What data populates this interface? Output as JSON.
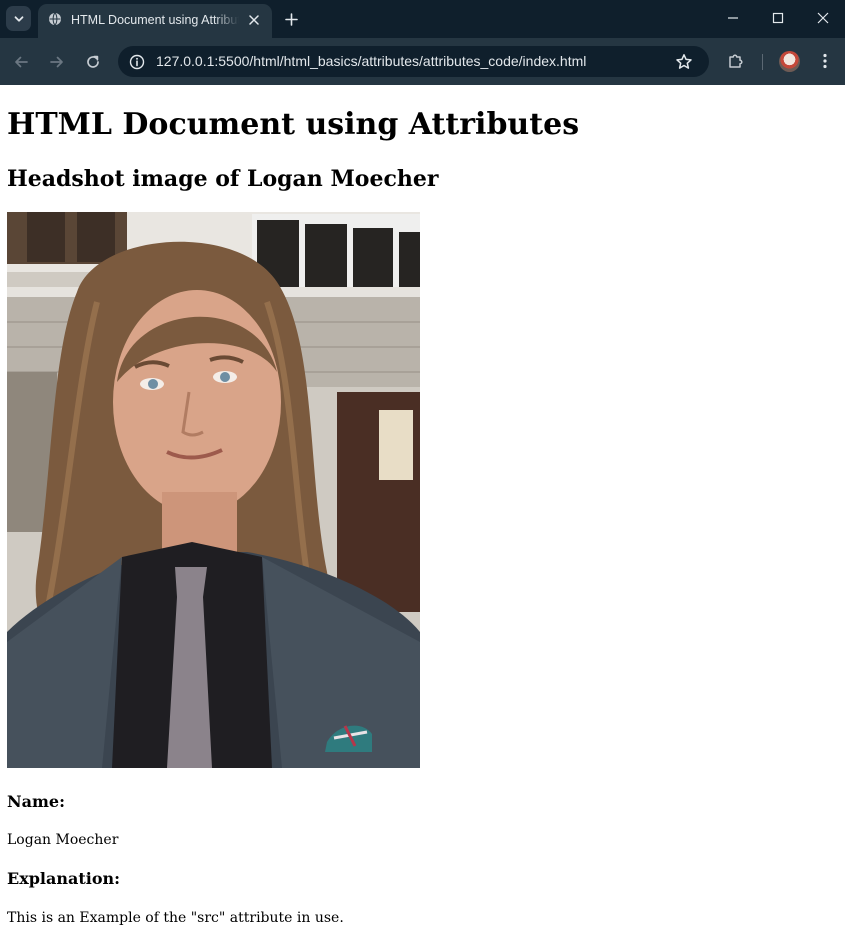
{
  "browser": {
    "tab": {
      "title": "HTML Document using Attributes"
    },
    "address_bar": {
      "url": "127.0.0.1:5500/html/html_basics/attributes/attributes_code/index.html"
    },
    "icons": {
      "tab_search": "chevron-down-icon",
      "favicon": "globe-icon",
      "tab_close": "close-icon",
      "new_tab": "plus-icon",
      "minimize": "minimize-icon",
      "maximize": "maximize-icon",
      "close_window": "close-icon",
      "back": "arrow-left-icon",
      "forward": "arrow-right-icon",
      "reload": "reload-icon",
      "site_info": "info-icon",
      "bookmark": "star-icon",
      "extensions": "puzzle-icon",
      "menu": "more-vertical-icon"
    },
    "colors": {
      "frame": "#0f1f2c",
      "toolbar": "#253642",
      "omnibox": "#0f1f2c",
      "text": "#e3e8ec",
      "icon": "#c6ccd2",
      "icon_disabled": "#6b7782"
    }
  },
  "page": {
    "heading": "HTML Document using Attributes",
    "subheading": "Headshot image of Logan Moecher",
    "name_label": "Name:",
    "name_value": "Logan Moecher",
    "explanation_label": "Explanation:",
    "explanation_text": "This is an Example of the \"src\" attribute in use."
  }
}
